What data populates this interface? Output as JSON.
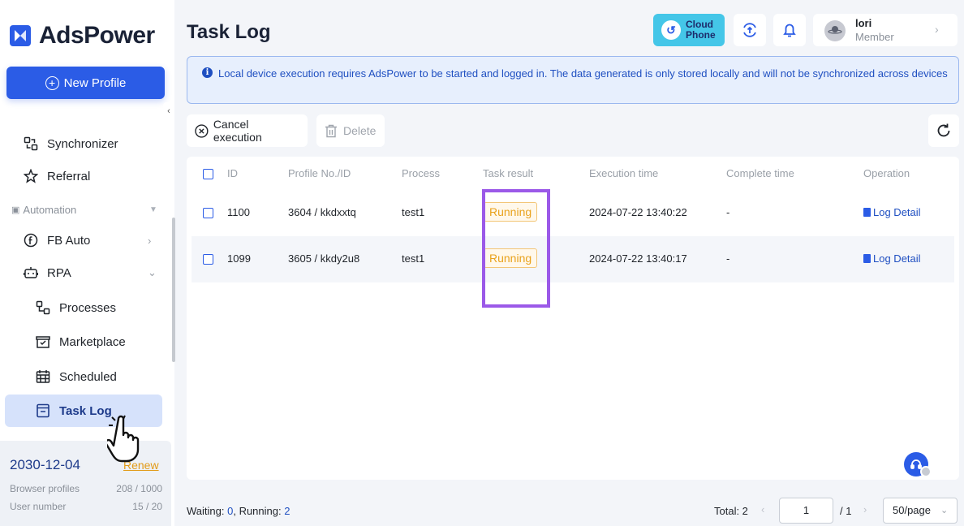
{
  "app": {
    "name": "AdsPower"
  },
  "sidebar": {
    "new_profile_label": "New Profile",
    "items": [
      {
        "label": "Synchronizer"
      },
      {
        "label": "Referral"
      }
    ],
    "section_label": "Automation",
    "automation": [
      {
        "label": "FB Auto"
      },
      {
        "label": "RPA"
      }
    ],
    "rpa_items": [
      {
        "label": "Processes"
      },
      {
        "label": "Marketplace"
      },
      {
        "label": "Scheduled"
      },
      {
        "label": "Task Log"
      }
    ],
    "plan": {
      "expiry_date": "2030-12-04",
      "renew_label": "Renew",
      "browser_profiles_label": "Browser profiles",
      "browser_profiles_value": "208 / 1000",
      "user_number_label": "User number",
      "user_number_value": "15 / 20"
    }
  },
  "header": {
    "title": "Task Log",
    "cloud_phone_line1": "Cloud",
    "cloud_phone_line2": "Phone",
    "user_name": "lori",
    "user_role": "Member"
  },
  "banner": {
    "text": "Local device execution requires AdsPower to be started and logged in. The data generated is only stored locally and will not be synchronized across devices"
  },
  "toolbar": {
    "cancel_label": "Cancel execution",
    "delete_label": "Delete"
  },
  "table": {
    "columns": [
      "ID",
      "Profile No./ID",
      "Process",
      "Task result",
      "Execution time",
      "Complete time",
      "Operation"
    ],
    "rows": [
      {
        "id": "1100",
        "profile": "3604 / kkdxxtq",
        "process": "test1",
        "result": "Running",
        "execution_time": "2024-07-22 13:40:22",
        "complete_time": "-",
        "operation": "Log Detail"
      },
      {
        "id": "1099",
        "profile": "3605 / kkdy2u8",
        "process": "test1",
        "result": "Running",
        "execution_time": "2024-07-22 13:40:17",
        "complete_time": "-",
        "operation": "Log Detail"
      }
    ]
  },
  "footer": {
    "waiting_label": "Waiting:",
    "waiting_count": "0",
    "running_label": ", Running:",
    "running_count": "2",
    "total_label": "Total: 2",
    "current_page": "1",
    "total_pages": "/ 1",
    "page_size": "50/page"
  },
  "colors": {
    "accent": "#2b5ce6",
    "highlight": "#9b59e8",
    "running": "#e9a21c"
  }
}
